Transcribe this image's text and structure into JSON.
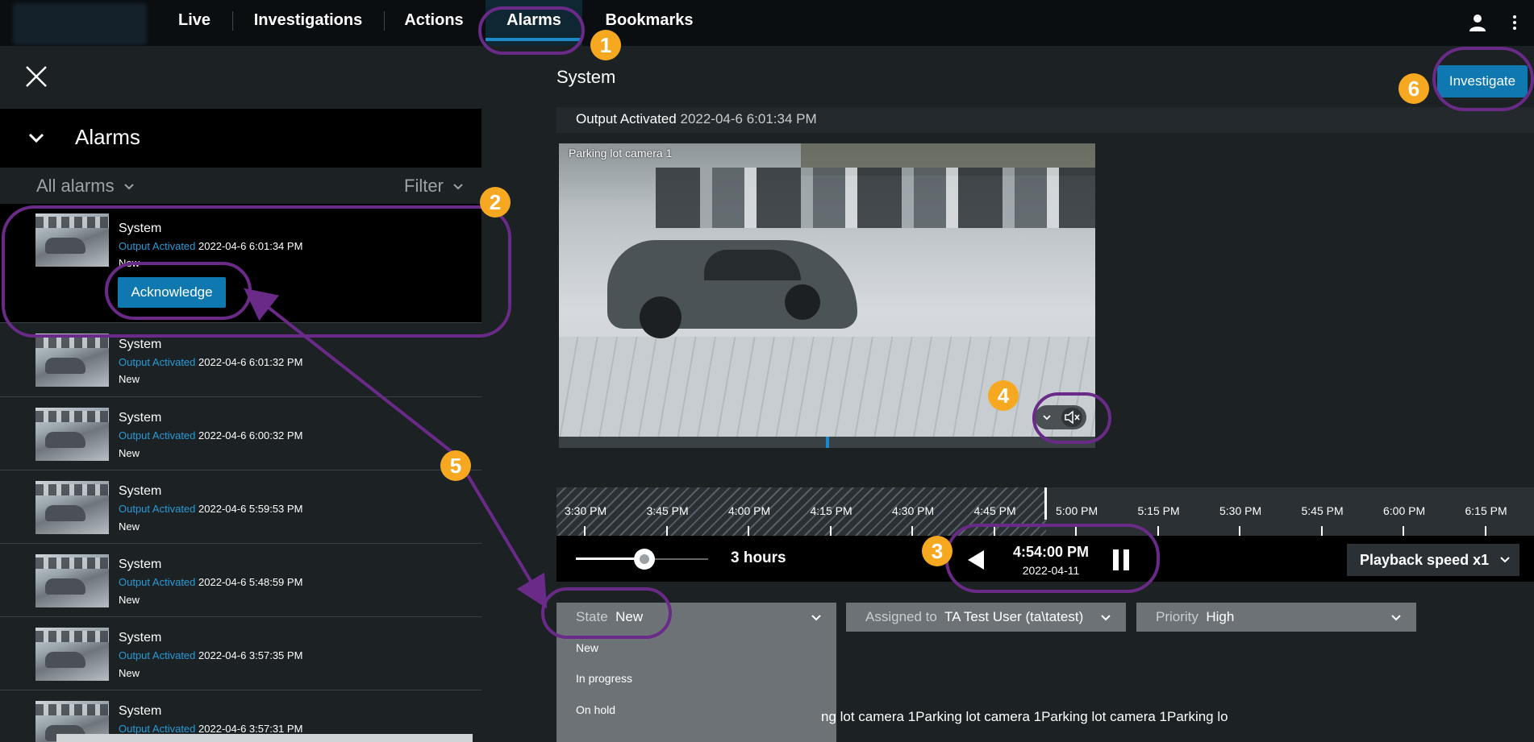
{
  "nav": {
    "items": [
      "Live",
      "Investigations",
      "Actions",
      "Alarms",
      "Bookmarks"
    ],
    "active": "Alarms"
  },
  "sidebar": {
    "title": "Alarms",
    "filter_scope": "All alarms",
    "filter_label": "Filter",
    "acknowledge_label": "Acknowledge",
    "alarms": [
      {
        "title": "System",
        "type": "Output Activated",
        "time": "2022-04-6 6:01:34 PM",
        "state": "New"
      },
      {
        "title": "System",
        "type": "Output Activated",
        "time": "2022-04-6 6:01:32 PM",
        "state": "New"
      },
      {
        "title": "System",
        "type": "Output Activated",
        "time": "2022-04-6 6:00:32 PM",
        "state": "New"
      },
      {
        "title": "System",
        "type": "Output Activated",
        "time": "2022-04-6 5:59:53 PM",
        "state": "New"
      },
      {
        "title": "System",
        "type": "Output Activated",
        "time": "2022-04-6 5:48:59 PM",
        "state": "New"
      },
      {
        "title": "System",
        "type": "Output Activated",
        "time": "2022-04-6 3:57:35 PM",
        "state": "New"
      },
      {
        "title": "System",
        "type": "Output Activated",
        "time": "2022-04-6 3:57:31 PM",
        "state": ""
      }
    ]
  },
  "detail": {
    "title": "System",
    "investigate_label": "Investigate",
    "event_label": "Output Activated",
    "event_time": "2022-04-6 6:01:34 PM",
    "camera_name": "Parking lot camera 1"
  },
  "timeline": {
    "labels": [
      "3:30 PM",
      "3:45 PM",
      "4:00 PM",
      "4:15 PM",
      "4:30 PM",
      "4:45 PM",
      "5:00 PM",
      "5:15 PM",
      "5:30 PM",
      "5:45 PM",
      "6:00 PM",
      "6:15 PM"
    ],
    "range_label": "3 hours",
    "current_time": "4:54:00 PM",
    "current_date": "2022-04-11",
    "playback_speed_label": "Playback speed x1"
  },
  "fields": {
    "state_label": "State",
    "state_value": "New",
    "assigned_label": "Assigned to",
    "assigned_value": "TA Test User (ta\\tatest)",
    "priority_label": "Priority",
    "priority_value": "High",
    "state_options": [
      "New",
      "In progress",
      "On hold"
    ]
  },
  "bottom_text": "ng lot camera 1Parking lot camera 1Parking lot camera 1Parking lo",
  "annotations": [
    "1",
    "2",
    "3",
    "4",
    "5",
    "6"
  ],
  "colors": {
    "accent": "#0f78b0",
    "annotation_ring": "#6a2a88",
    "annotation_badge": "#f6a821",
    "link": "#2a9ad6"
  }
}
